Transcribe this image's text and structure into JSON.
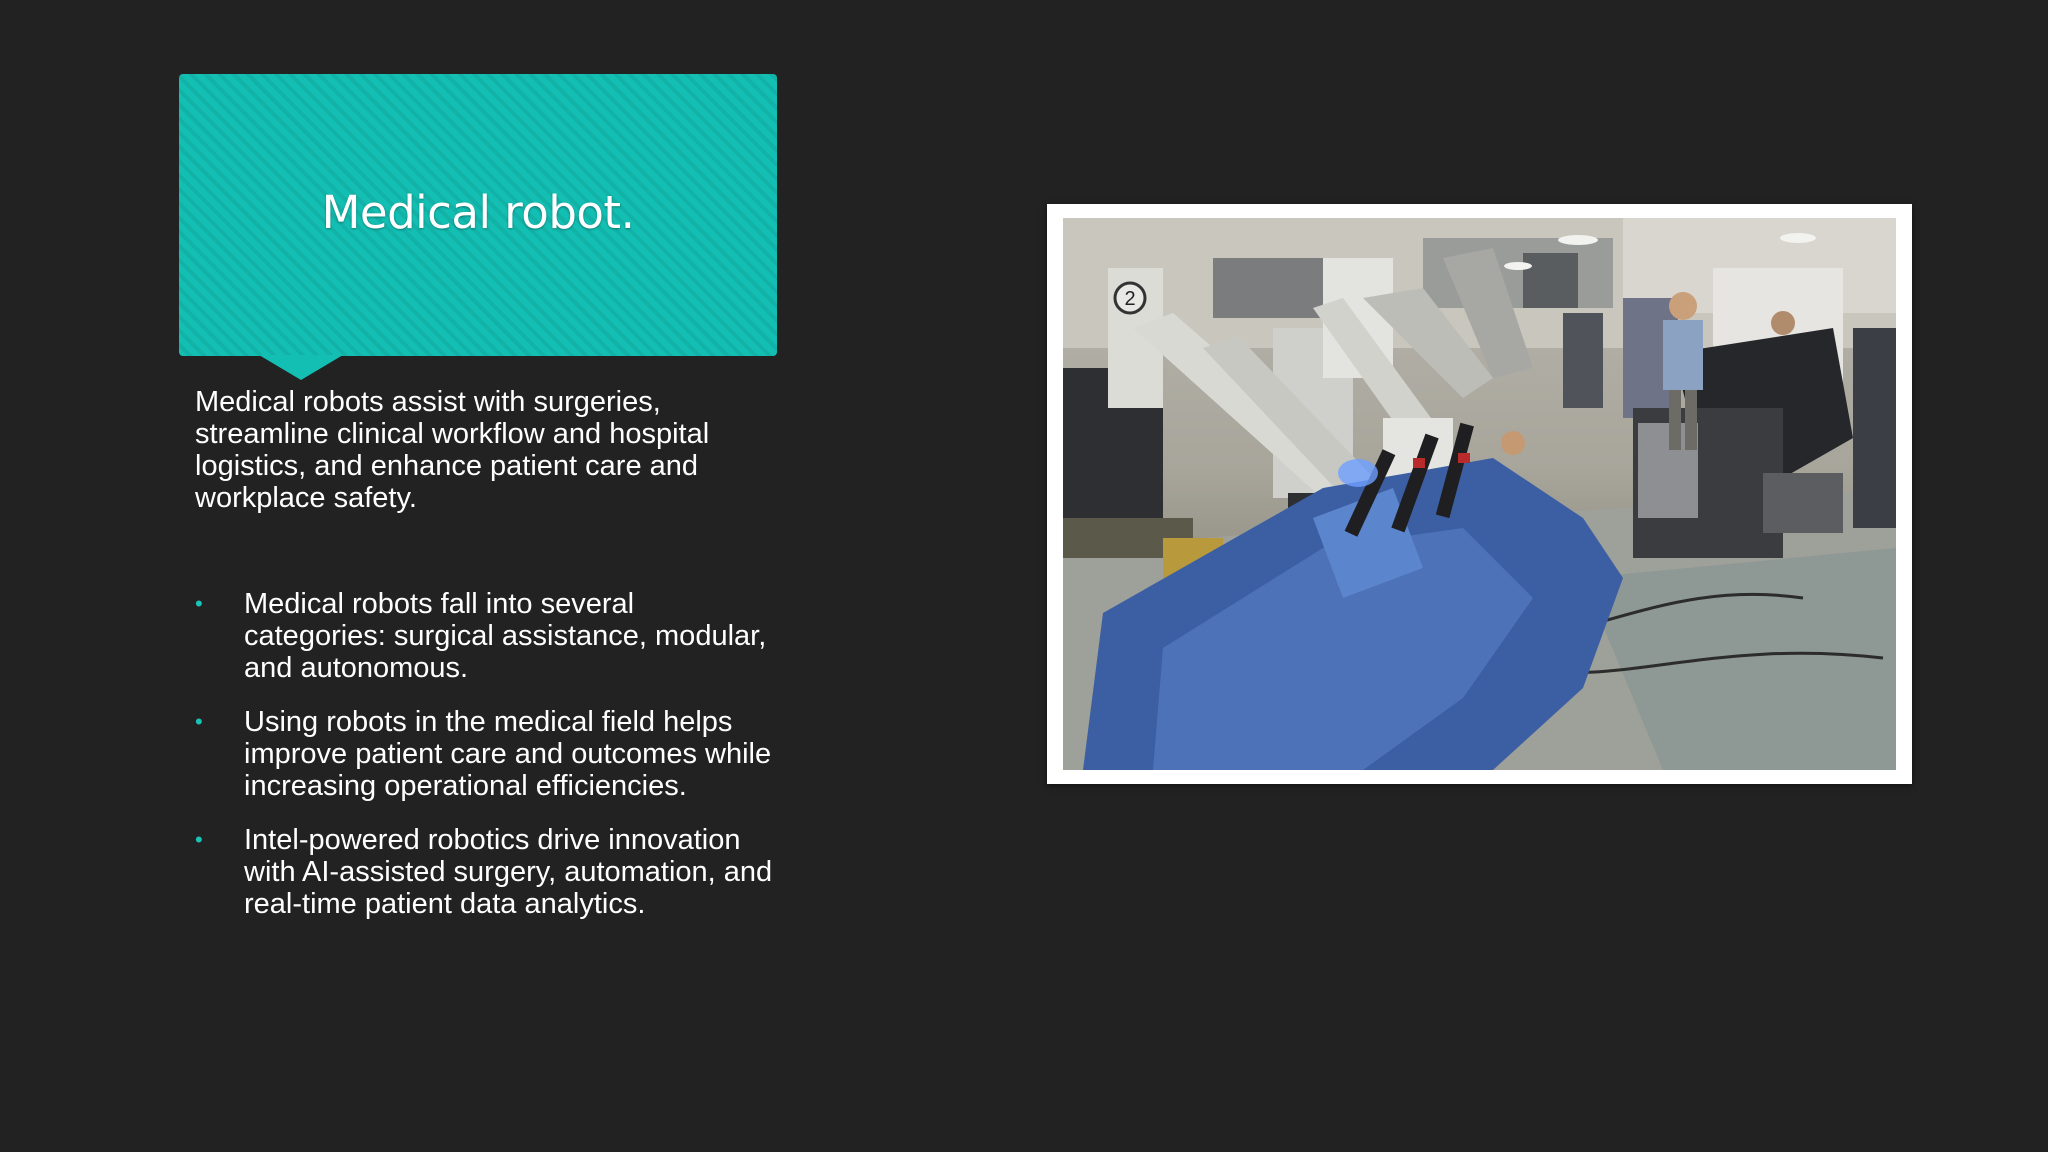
{
  "slide": {
    "title": "Medical robot.",
    "intro": "Medical robots assist with surgeries, streamline clinical workflow and hospital logistics, and enhance patient care and workplace safety.",
    "bullets": [
      "Medical robots fall into several categories: surgical assistance, modular, and autonomous.",
      "Using robots in the medical field helps improve patient care and outcomes while increasing operational efficiencies.",
      "Intel-powered robotics drive innovation with AI-assisted surgery, automation, and real-time patient data analytics."
    ],
    "bullet_glyph": "•",
    "photo": {
      "arm_number": "2"
    }
  },
  "colors": {
    "background": "#222223",
    "accent": "#13bfb3",
    "text": "#ffffff"
  }
}
